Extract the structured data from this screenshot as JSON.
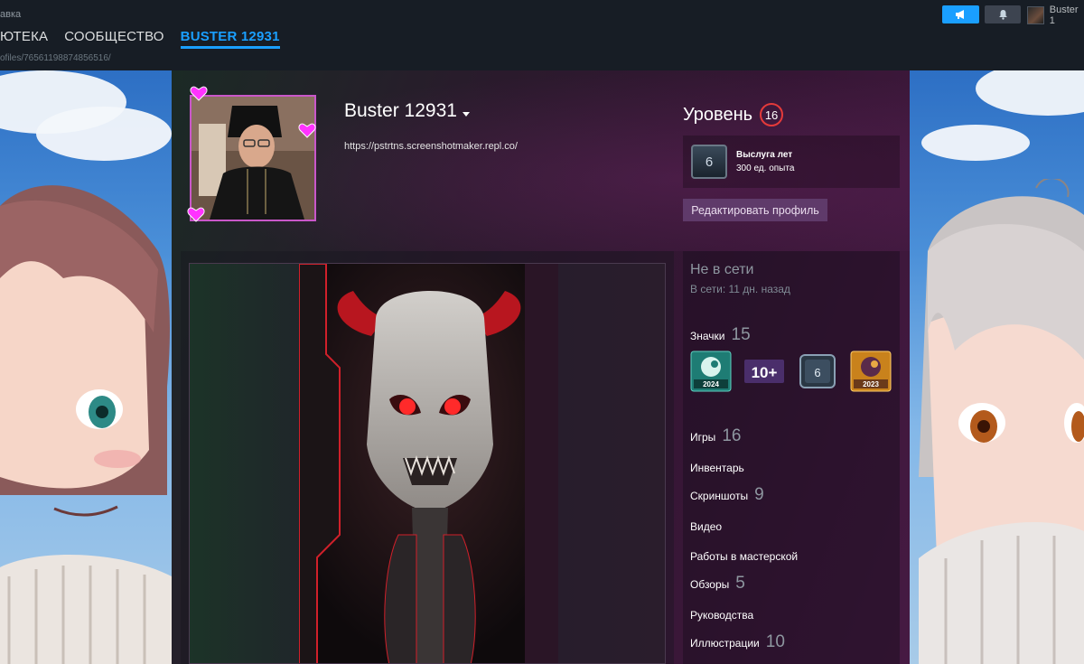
{
  "topbar": {
    "menu_fragment": "авка",
    "nav": [
      {
        "label": "ЮТЕКА"
      },
      {
        "label": "СООБЩЕСТВО"
      },
      {
        "label": "BUSTER 12931"
      }
    ],
    "url_fragment": "ofiles/76561198874856516/",
    "username": "Buster 1"
  },
  "profile": {
    "persona_name": "Buster 12931",
    "summary": "https://pstrtns.screenshotmaker.repl.co/",
    "level_label": "Уровень",
    "level_value": "16",
    "years_badge_value": "6",
    "years_title": "Выслуга лет",
    "years_xp": "300 ед. опыта",
    "edit_button": "Редактировать профиль"
  },
  "rightcol": {
    "status": "Не в сети",
    "last_online": "В сети: 11 дн. назад",
    "badges_label": "Значки",
    "badges_count": "15",
    "badges": [
      {
        "icon": "steam-2024-badge-icon",
        "text": "2024"
      },
      {
        "icon": "level-10-plus-badge-icon",
        "text": "10+"
      },
      {
        "icon": "years-of-service-badge-icon",
        "text": "6"
      },
      {
        "icon": "steam-2023-badge-icon",
        "text": "2023"
      }
    ],
    "links": [
      {
        "label": "Игры",
        "count": "16"
      },
      {
        "label": "Инвентарь",
        "count": ""
      },
      {
        "label": "Скриншоты",
        "count": "9"
      },
      {
        "label": "Видео",
        "count": ""
      },
      {
        "label": "Работы в мастерской",
        "count": ""
      },
      {
        "label": "Обзоры",
        "count": "5"
      },
      {
        "label": "Руководства",
        "count": ""
      },
      {
        "label": "Иллюстрации",
        "count": "10"
      }
    ]
  },
  "colors": {
    "accent_blue": "#1a9fff",
    "level_ring": "#e43a3a",
    "heart_pink": "#ff33ff",
    "edit_button": "#5f3a6a"
  }
}
